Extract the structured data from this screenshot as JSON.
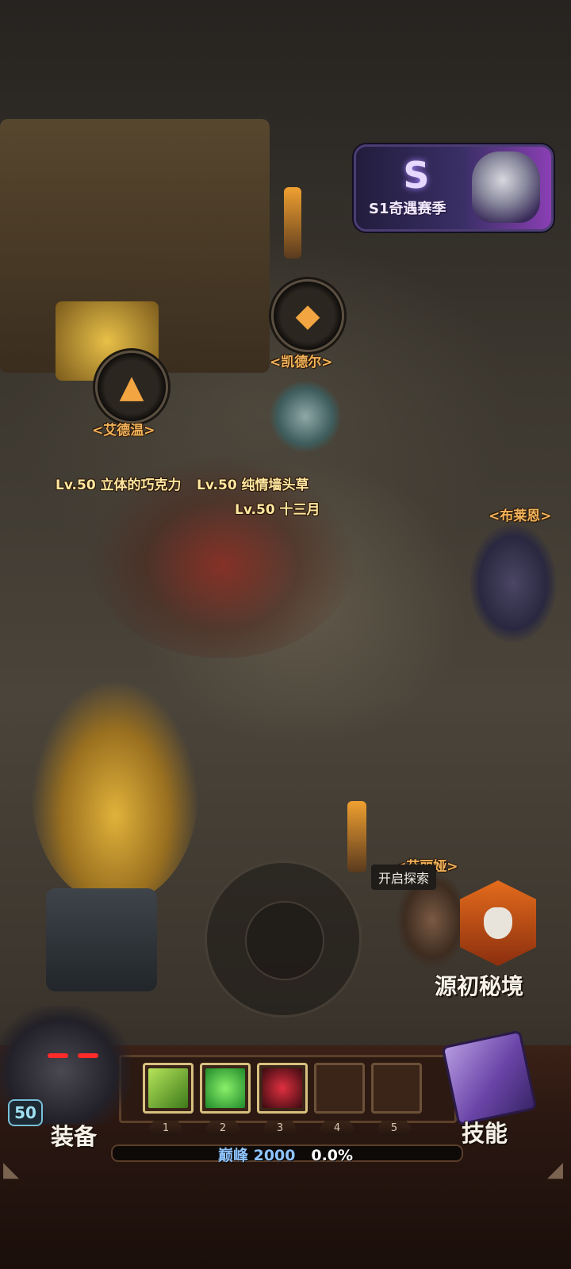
{
  "season_event": {
    "label": "S1奇遇赛季"
  },
  "npcs": [
    {
      "name": "<艾德温>",
      "icon": "fox-icon"
    },
    {
      "name": "<凯德尔>",
      "icon": "rune-icon"
    },
    {
      "name": "<布莱恩>"
    },
    {
      "name": "<艾丽娅>",
      "bubble": "开启探索"
    }
  ],
  "players": [
    {
      "tag": "Lv.50 立体的巧克力"
    },
    {
      "tag": "Lv.50 纯情墙头草"
    },
    {
      "tag": "Lv.50 十三月"
    }
  ],
  "secret_realm": {
    "label": "源初秘境"
  },
  "hud": {
    "level": "50",
    "equip_label": "装备",
    "skill_label": "技能",
    "skill_slots": [
      {
        "num": "1",
        "skill": "spear-strike-icon",
        "color": "#6fbf3a"
      },
      {
        "num": "2",
        "skill": "whirlwind-icon",
        "color": "#2fbf3a"
      },
      {
        "num": "3",
        "skill": "dark-shadow-icon",
        "color": "#c0202a"
      },
      {
        "num": "4",
        "skill": ""
      },
      {
        "num": "5",
        "skill": ""
      }
    ],
    "peak_label": "巅峰",
    "peak_value": "2000",
    "progress_text": "0.0%",
    "progress": 0.0
  }
}
